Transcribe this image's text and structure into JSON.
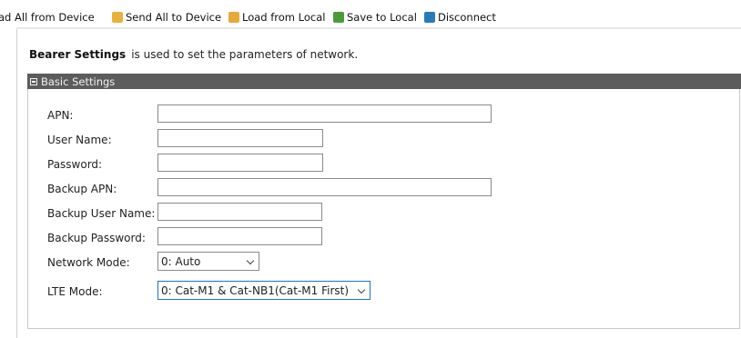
{
  "toolbar": {
    "items": [
      {
        "label": "ad All from Device",
        "icon": "device-icon",
        "color": "#3b6fb6"
      },
      {
        "label": "Send All to Device",
        "icon": "send-icon",
        "color": "#e0a020"
      },
      {
        "label": "Load from Local",
        "icon": "folder-open-icon",
        "color": "#e6a93a"
      },
      {
        "label": "Save to Local",
        "icon": "save-icon",
        "color": "#4a9a3a"
      },
      {
        "label": "Disconnect",
        "icon": "disconnect-icon",
        "color": "#2a7ab8"
      }
    ]
  },
  "intro": {
    "title": "Bearer Settings",
    "text": "is used to set the parameters of network."
  },
  "section": {
    "title": "Basic Settings"
  },
  "form": {
    "apn_label": "APN:",
    "apn_value": "",
    "user_name_label": "User Name:",
    "user_name_value": "",
    "password_label": "Password:",
    "password_value": "",
    "backup_apn_label": "Backup APN:",
    "backup_apn_value": "",
    "backup_user_name_label": "Backup User Name:",
    "backup_user_name_value": "",
    "backup_password_label": "Backup Password:",
    "backup_password_value": "",
    "network_mode_label": "Network Mode:",
    "network_mode_value": "0: Auto",
    "lte_mode_label": "LTE Mode:",
    "lte_mode_value": "0: Cat-M1 & Cat-NB1(Cat-M1 First)"
  },
  "colors": {
    "section_bar": "#5c5c5c",
    "focus_border": "#1d73c9"
  }
}
